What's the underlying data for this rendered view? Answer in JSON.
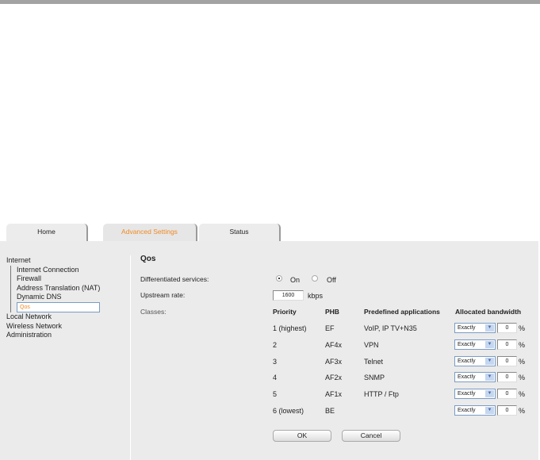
{
  "tabs": [
    {
      "label": "Home"
    },
    {
      "label": "Advanced Settings",
      "active": true
    },
    {
      "label": "Status"
    }
  ],
  "nav": {
    "internet": "Internet",
    "sub": [
      "Internet Connection",
      "Firewall",
      "Address Translation (NAT)",
      "Dynamic DNS",
      "Qos"
    ],
    "local": "Local Network",
    "wireless": "Wireless Network",
    "admin": "Administration"
  },
  "main": {
    "title": "Qos",
    "diff_label": "Differentiated services:",
    "on": "On",
    "off": "Off",
    "diff_value": "On",
    "upstream_label": "Upstream rate:",
    "upstream_value": "1600",
    "upstream_unit": "kbps",
    "classes_label": "Classes:",
    "headers": {
      "priority": "Priority",
      "phb": "PHB",
      "apps": "Predefined applications",
      "bw": "Allocated bandwidth"
    },
    "rows": [
      {
        "priority": "1 (highest)",
        "phb": "EF",
        "apps": "VoIP, IP TV+N35",
        "mode": "Exactly",
        "value": "0",
        "unit": "%"
      },
      {
        "priority": "2",
        "phb": "AF4x",
        "apps": "VPN",
        "mode": "Exactly",
        "value": "0",
        "unit": "%"
      },
      {
        "priority": "3",
        "phb": "AF3x",
        "apps": "Telnet",
        "mode": "Exactly",
        "value": "0",
        "unit": "%"
      },
      {
        "priority": "4",
        "phb": "AF2x",
        "apps": "SNMP",
        "mode": "Exactly",
        "value": "0",
        "unit": "%"
      },
      {
        "priority": "5",
        "phb": "AF1x",
        "apps": "HTTP / Ftp",
        "mode": "Exactly",
        "value": "0",
        "unit": "%"
      },
      {
        "priority": "6 (lowest)",
        "phb": "BE",
        "apps": "",
        "mode": "Exactly",
        "value": "0",
        "unit": "%"
      }
    ],
    "ok": "OK",
    "cancel": "Cancel"
  },
  "colors": {
    "accent": "#f08a24",
    "panel": "#ebebeb"
  }
}
